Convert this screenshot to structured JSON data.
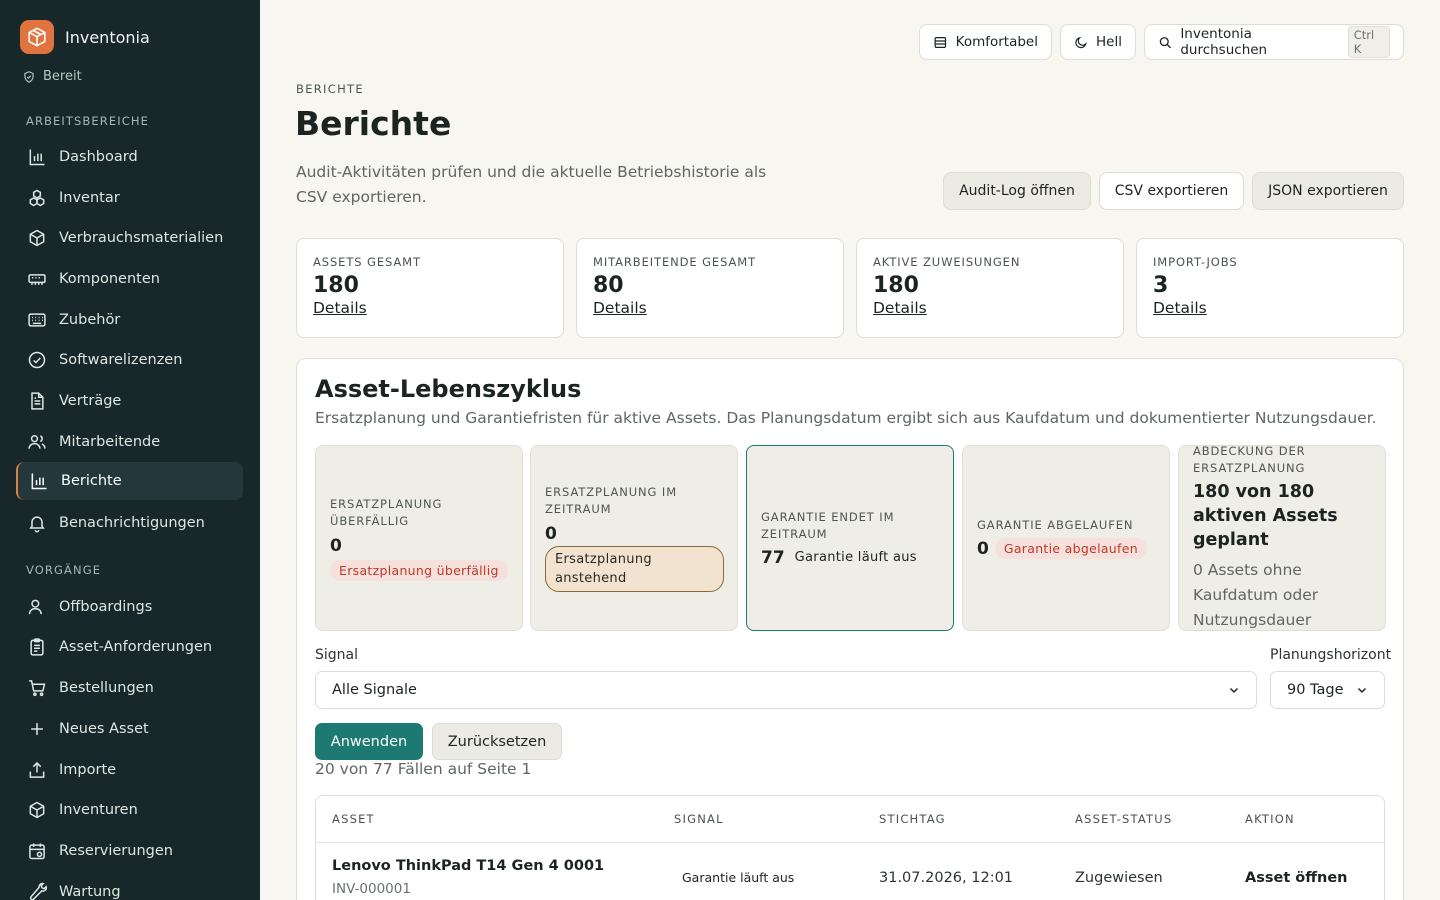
{
  "app": {
    "name": "Inventonia",
    "status": "Bereit"
  },
  "sidebar": {
    "section_workspaces": "ARBEITSBEREICHE",
    "workspaces": [
      {
        "label": "Dashboard",
        "icon": "bar-chart-icon"
      },
      {
        "label": "Inventar",
        "icon": "boxes-icon"
      },
      {
        "label": "Verbrauchsmaterialien",
        "icon": "package-icon"
      },
      {
        "label": "Komponenten",
        "icon": "memory-icon"
      },
      {
        "label": "Zubehör",
        "icon": "keyboard-icon"
      },
      {
        "label": "Softwarelizenzen",
        "icon": "badge-check-icon"
      },
      {
        "label": "Verträge",
        "icon": "document-icon"
      },
      {
        "label": "Mitarbeitende",
        "icon": "users-icon"
      },
      {
        "label": "Berichte",
        "icon": "bar-chart-icon",
        "active": true
      },
      {
        "label": "Benachrichtigungen",
        "icon": "bell-icon"
      }
    ],
    "section_processes": "VORGÄNGE",
    "processes": [
      {
        "label": "Offboardings",
        "icon": "user-minus-icon"
      },
      {
        "label": "Asset-Anforderungen",
        "icon": "clipboard-icon"
      },
      {
        "label": "Bestellungen",
        "icon": "cart-icon"
      },
      {
        "label": "Neues Asset",
        "icon": "plus-icon"
      },
      {
        "label": "Importe",
        "icon": "upload-icon"
      },
      {
        "label": "Inventuren",
        "icon": "package-icon"
      },
      {
        "label": "Reservierungen",
        "icon": "calendar-icon"
      },
      {
        "label": "Wartung",
        "icon": "wrench-icon"
      }
    ]
  },
  "topbar": {
    "density": "Komfortabel",
    "theme": "Hell",
    "search": "Inventonia durchsuchen",
    "shortcut": "Ctrl K"
  },
  "header": {
    "eyebrow": "BERICHTE",
    "title": "Berichte",
    "description": "Audit-Aktivitäten prüfen und die aktuelle Betriebshistorie als CSV exportieren.",
    "actions": {
      "audit_log": "Audit-Log öffnen",
      "csv": "CSV exportieren",
      "json": "JSON exportieren"
    }
  },
  "stats": [
    {
      "label": "ASSETS GESAMT",
      "value": "180",
      "link": "Details"
    },
    {
      "label": "MITARBEITENDE GESAMT",
      "value": "80",
      "link": "Details"
    },
    {
      "label": "AKTIVE ZUWEISUNGEN",
      "value": "180",
      "link": "Details"
    },
    {
      "label": "IMPORT-JOBS",
      "value": "3",
      "link": "Details"
    }
  ],
  "lifecycle": {
    "title": "Asset-Lebenszyklus",
    "description": "Ersatzplanung und Garantiefristen für aktive Assets. Das Planungsdatum ergibt sich aus Kaufdatum und dokumentierter Nutzungsdauer.",
    "cards": [
      {
        "label": "ERSATZPLANUNG ÜBERFÄLLIG",
        "value": "0",
        "tag": "Ersatzplanung überfällig"
      },
      {
        "label": "ERSATZPLANUNG IM ZEITRAUM",
        "value": "0",
        "tag": "Ersatzplanung anstehend"
      },
      {
        "label": "GARANTIE ENDET IM ZEITRAUM",
        "value": "77",
        "tag": "Garantie läuft aus"
      },
      {
        "label": "GARANTIE ABGELAUFEN",
        "value": "0",
        "tag": "Garantie abgelaufen"
      },
      {
        "label": "ABDECKUNG DER ERSATZPLANUNG",
        "value": "180 von 180 aktiven Assets geplant",
        "note": "0 Assets ohne Kaufdatum oder Nutzungsdauer"
      }
    ],
    "filters": {
      "signal_label": "Signal",
      "signal_value": "Alle Signale",
      "horizon_label": "Planungshorizont",
      "horizon_value": "90 Tage",
      "apply": "Anwenden",
      "reset": "Zurücksetzen"
    },
    "count_text": "20 von 77 Fällen auf Seite 1",
    "table": {
      "columns": [
        "ASSET",
        "SIGNAL",
        "STICHTAG",
        "ASSET-STATUS",
        "AKTION"
      ],
      "rows": [
        {
          "asset": "Lenovo ThinkPad T14 Gen 4 0001",
          "tag": "INV-000001",
          "signal": "Garantie läuft aus",
          "date": "31.07.2026, 12:01",
          "status": "Zugewiesen",
          "action": "Asset öffnen"
        }
      ]
    }
  }
}
